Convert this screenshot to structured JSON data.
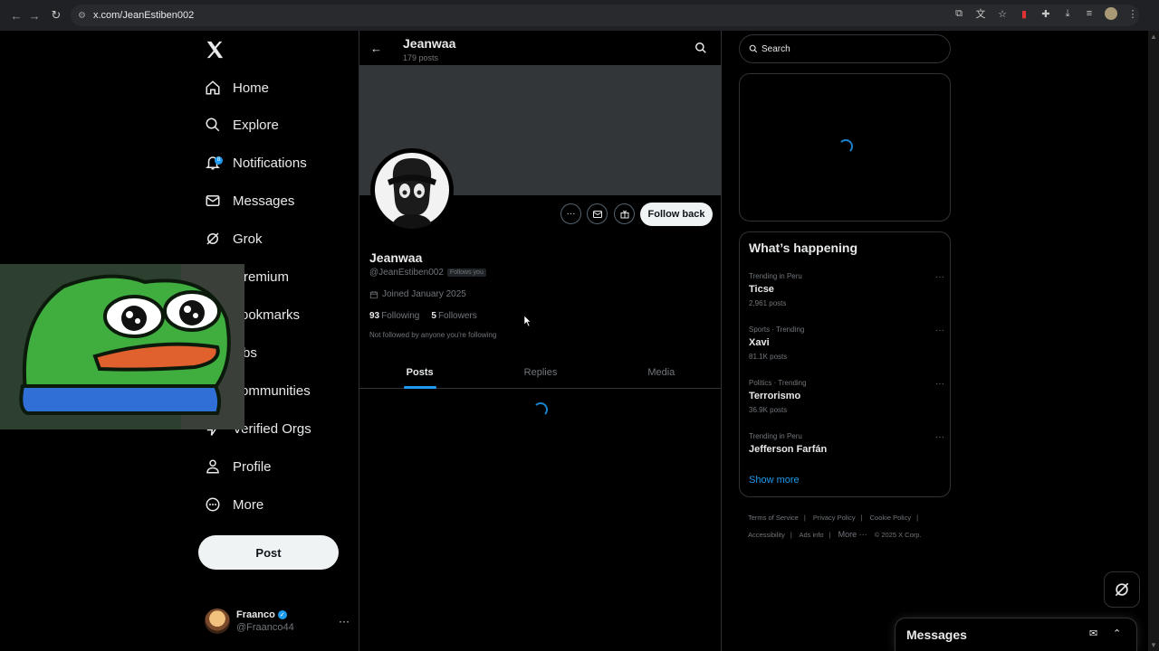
{
  "browser": {
    "url": "x.com/JeanEstiben002"
  },
  "leftnav": {
    "items": [
      {
        "label": "Home",
        "icon": "home-icon"
      },
      {
        "label": "Explore",
        "icon": "search-icon"
      },
      {
        "label": "Notifications",
        "icon": "bell-icon"
      },
      {
        "label": "Messages",
        "icon": "envelope-icon"
      },
      {
        "label": "Grok",
        "icon": "grok-icon"
      },
      {
        "label": "remium",
        "icon": "premium-icon"
      },
      {
        "label": "ookmarks",
        "icon": "bookmark-icon"
      },
      {
        "label": "bs",
        "icon": "jobs-icon"
      },
      {
        "label": "ommunities",
        "icon": "communities-icon"
      },
      {
        "label": "Verified Orgs",
        "icon": "lightning-icon"
      },
      {
        "label": "Profile",
        "icon": "person-icon"
      },
      {
        "label": "More",
        "icon": "more-circle-icon"
      }
    ],
    "notif_count": "8",
    "post_label": "Post",
    "account": {
      "name": "Fraanco",
      "handle": "@Fraanco44"
    }
  },
  "profile": {
    "header_name": "Jeanwaa",
    "post_count": "179 posts",
    "name": "Jeanwaa",
    "handle": "@JeanEstiben002",
    "follows_you": "Follows you",
    "joined": "Joined January 2025",
    "following_count": "93",
    "following_label": "Following",
    "followers_count": "5",
    "followers_label": "Followers",
    "not_followed": "Not followed by anyone you're following",
    "follow_back": "Follow back",
    "tabs": [
      "Posts",
      "Replies",
      "Media"
    ],
    "active_tab": "Posts"
  },
  "right": {
    "search_placeholder": "Search",
    "whats_happening": "What’s happening",
    "trends": [
      {
        "meta": "Trending in Peru",
        "topic": "Ticse",
        "count": "2,961 posts"
      },
      {
        "meta": "Sports · Trending",
        "topic": "Xavi",
        "count": "81.1K posts"
      },
      {
        "meta": "Politics · Trending",
        "topic": "Terrorismo",
        "count": "36.9K posts"
      },
      {
        "meta": "Trending in Peru",
        "topic": "Jefferson Farfán",
        "count": ""
      }
    ],
    "show_more": "Show more",
    "footer": [
      "Terms of Service",
      "|",
      "Privacy Policy",
      "|",
      "Cookie Policy",
      "|",
      "Accessibility",
      "|",
      "Ads info",
      "|",
      "More ···",
      "© 2025 X Corp."
    ]
  },
  "messages_drawer": {
    "title": "Messages"
  },
  "colors": {
    "accent": "#1d9bf0",
    "bg": "#000000",
    "text": "#e7e9ea",
    "muted": "#71767b"
  }
}
